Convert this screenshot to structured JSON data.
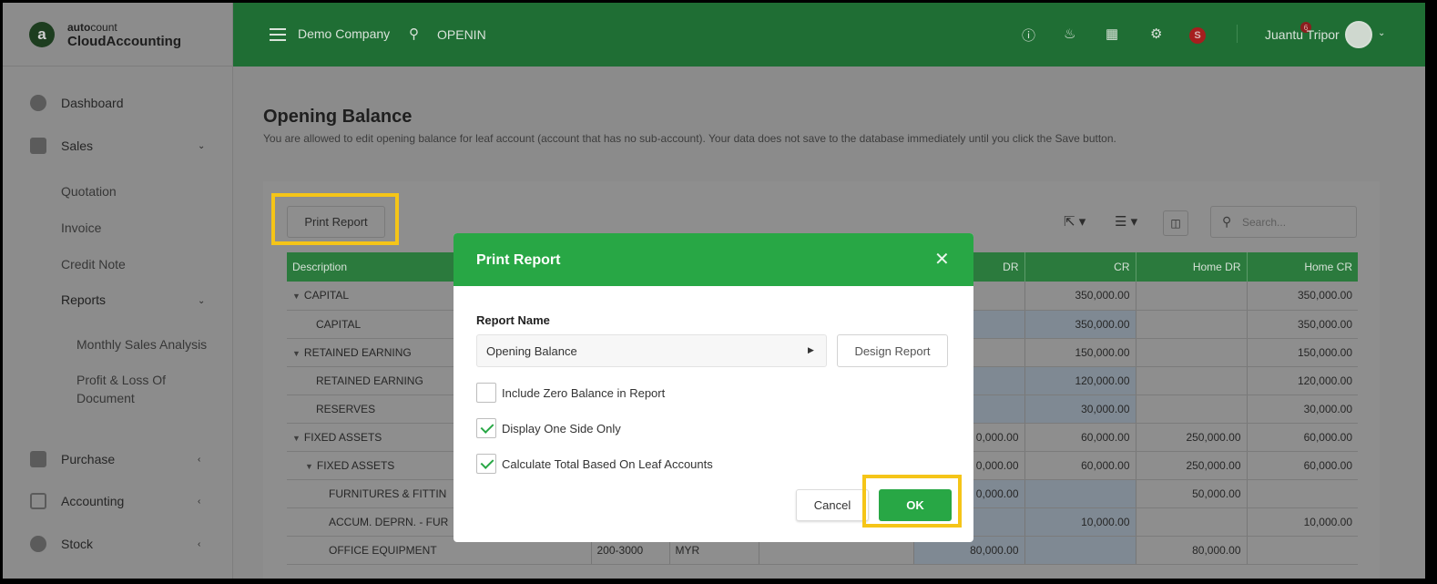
{
  "brand": {
    "top_bold": "auto",
    "top_regular": "count",
    "bottom": "CloudAccounting",
    "logo_letter": "a"
  },
  "header": {
    "company": "Demo Company",
    "database": "OPENIN",
    "notification_count": "6",
    "s_badge": "S",
    "user": "Juantu Tripor",
    "icons": [
      "help-icon",
      "bell-icon",
      "apps-grid-icon",
      "gear-icon"
    ]
  },
  "sidebar": {
    "items": [
      {
        "label": "Dashboard",
        "icon": "dashboard-icon"
      },
      {
        "label": "Sales",
        "icon": "sales-icon",
        "chevron": "⌄"
      },
      {
        "label": "Purchase",
        "icon": "purchase-icon",
        "chevron": "‹"
      },
      {
        "label": "Accounting",
        "icon": "accounting-icon",
        "chevron": "‹"
      },
      {
        "label": "Stock",
        "icon": "stock-icon",
        "chevron": "‹"
      }
    ],
    "sales_sub": [
      "Quotation",
      "Invoice",
      "Credit Note",
      "Reports"
    ],
    "reports_chevron": "⌄",
    "reports_sub": [
      "Monthly Sales Analysis",
      "Profit & Loss Of",
      "Document"
    ]
  },
  "page": {
    "title": "Opening Balance",
    "description": "You are allowed to edit opening balance for leaf account (account that has no sub-account). Your data does not save to the database immediately until you click the Save button.",
    "print_button": "Print Report",
    "search_placeholder": "Search..."
  },
  "table": {
    "headers": [
      "Description",
      "",
      "",
      "",
      "DR",
      "CR",
      "Home DR",
      "Home CR"
    ],
    "rows": [
      {
        "desc": "CAPITAL",
        "caret": true,
        "indent": 0,
        "code": "",
        "cur": "",
        "dr": "",
        "cr": "350,000.00",
        "hdr": "",
        "hcr": "350,000.00"
      },
      {
        "desc": "CAPITAL",
        "caret": false,
        "indent": 1,
        "code": "",
        "cur": "",
        "dr": "",
        "cr": "350,000.00",
        "hdr": "",
        "hcr": "350,000.00"
      },
      {
        "desc": "RETAINED EARNING",
        "caret": true,
        "indent": 0,
        "code": "",
        "cur": "",
        "dr": "",
        "cr": "150,000.00",
        "hdr": "",
        "hcr": "150,000.00"
      },
      {
        "desc": "RETAINED EARNING",
        "caret": false,
        "indent": 1,
        "code": "",
        "cur": "",
        "dr": "",
        "cr": "120,000.00",
        "hdr": "",
        "hcr": "120,000.00"
      },
      {
        "desc": "RESERVES",
        "caret": false,
        "indent": 1,
        "code": "",
        "cur": "",
        "dr": "",
        "cr": "30,000.00",
        "hdr": "",
        "hcr": "30,000.00"
      },
      {
        "desc": "FIXED ASSETS",
        "caret": true,
        "indent": 0,
        "code": "",
        "cur": "",
        "dr": "0,000.00",
        "cr": "60,000.00",
        "hdr": "250,000.00",
        "hcr": "60,000.00"
      },
      {
        "desc": "FIXED ASSETS",
        "caret": true,
        "indent": 1,
        "code": "",
        "cur": "",
        "dr": "0,000.00",
        "cr": "60,000.00",
        "hdr": "250,000.00",
        "hcr": "60,000.00"
      },
      {
        "desc": "FURNITURES & FITTIN",
        "caret": false,
        "indent": 2,
        "code": "",
        "cur": "",
        "dr": "0,000.00",
        "cr": "",
        "hdr": "50,000.00",
        "hcr": ""
      },
      {
        "desc": "ACCUM. DEPRN. - FUR",
        "caret": false,
        "indent": 2,
        "code": "",
        "cur": "",
        "dr": "",
        "cr": "10,000.00",
        "hdr": "",
        "hcr": "10,000.00"
      },
      {
        "desc": "OFFICE EQUIPMENT",
        "caret": false,
        "indent": 2,
        "code": "200-3000",
        "cur": "MYR",
        "dr": "80,000.00",
        "cr": "",
        "hdr": "80,000.00",
        "hcr": ""
      }
    ]
  },
  "modal": {
    "title": "Print Report",
    "report_name_label": "Report Name",
    "report_name_value": "Opening Balance",
    "design_button": "Design Report",
    "checkboxes": [
      {
        "label": "Include Zero Balance in Report",
        "checked": false
      },
      {
        "label": "Display One Side Only",
        "checked": true
      },
      {
        "label": "Calculate Total Based On Leaf Accounts",
        "checked": true
      }
    ],
    "cancel_button": "Cancel",
    "ok_button": "OK"
  },
  "colors": {
    "brand_green": "#28a745",
    "highlight_yellow": "#f5c518",
    "badge_red": "#a61e1e"
  }
}
